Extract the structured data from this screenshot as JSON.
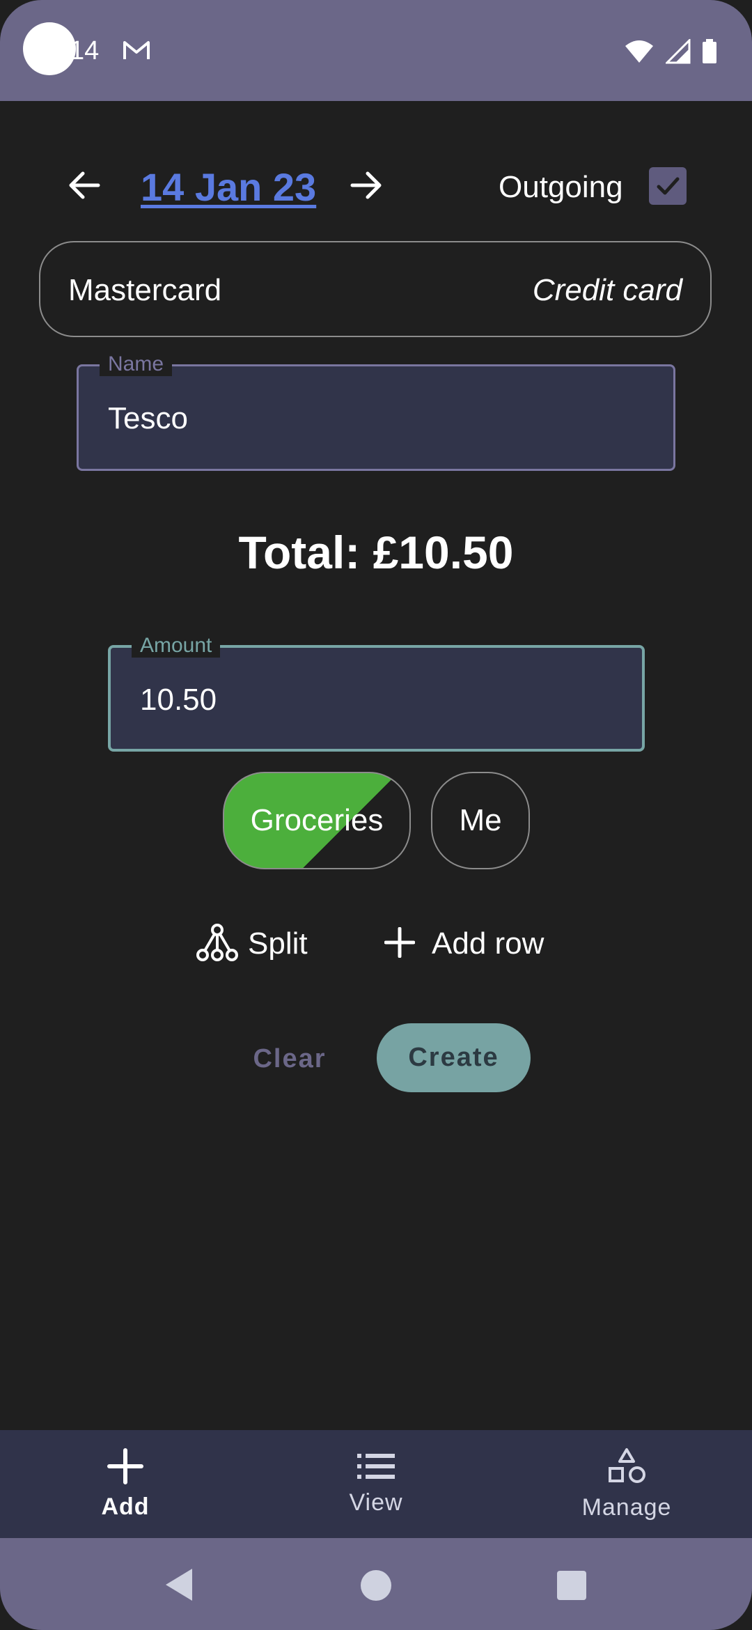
{
  "status_bar": {
    "time": "14",
    "icons": [
      "gmail-icon",
      "wifi-icon",
      "signal-icon",
      "battery-icon"
    ]
  },
  "header": {
    "date": "14 Jan 23",
    "outgoing_label": "Outgoing",
    "outgoing_checked": true
  },
  "account": {
    "name": "Mastercard",
    "type": "Credit card"
  },
  "name_field": {
    "label": "Name",
    "value": "Tesco"
  },
  "total": "Total: £10.50",
  "amount_field": {
    "label": "Amount",
    "value": "10.50"
  },
  "chips": [
    {
      "label": "Groceries",
      "color": "#4caf3c"
    },
    {
      "label": "Me"
    }
  ],
  "actions": {
    "split_label": "Split",
    "add_row_label": "Add row"
  },
  "buttons": {
    "clear_label": "Clear",
    "create_label": "Create"
  },
  "bottom_nav": [
    {
      "label": "Add",
      "icon": "plus-icon",
      "selected": true
    },
    {
      "label": "View",
      "icon": "list-icon",
      "selected": false
    },
    {
      "label": "Manage",
      "icon": "shapes-icon",
      "selected": false
    }
  ],
  "colors": {
    "background": "#1f1f1f",
    "accent_purple": "#6b6788",
    "accent_teal": "#77a3a3",
    "link_blue": "#5a7ae0",
    "nav_background": "#30334a"
  }
}
